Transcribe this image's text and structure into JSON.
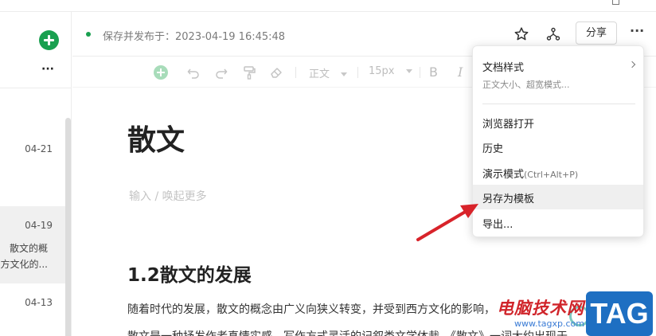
{
  "header": {
    "status_text": "保存并发布于：2023-04-19 16:45:48",
    "share_label": "分享",
    "more_label": "···"
  },
  "sidebar": {
    "more_label": "···",
    "items": [
      {
        "date": "04-21",
        "snippet1": "",
        "snippet2": ""
      },
      {
        "date": "04-19",
        "snippet1": "散文的概",
        "snippet2": "方文化的..."
      },
      {
        "date": "04-13",
        "snippet1": "",
        "snippet2": ""
      }
    ]
  },
  "toolbar": {
    "style_select": "正文",
    "size_select": "15px",
    "bold_label": "B",
    "italic_label": "I"
  },
  "editor": {
    "title": "散文",
    "placeholder": "输入 / 唤起更多",
    "heading": "1.2散文的发展",
    "paragraph1": "随着时代的发展，散文的概念由广义向狭义转变，并受到西方文化的影响，",
    "paragraph2": "散文是一种抒发作者真情实感、写作方式灵活的记叙类文学体裁。《散文》一词大约出现于"
  },
  "menu": {
    "items": [
      {
        "label": "文档样式",
        "sub": "正文大小、超宽模式...",
        "has_submenu": true
      },
      {
        "label": "浏览器打开"
      },
      {
        "label": "历史"
      },
      {
        "label": "演示模式",
        "hint": "(Ctrl+Alt+P)"
      },
      {
        "label": "另存为模板",
        "highlighted": true
      },
      {
        "label": "导出..."
      }
    ]
  },
  "watermark": {
    "text": "电脑技术网",
    "url": "www.tagxp.com",
    "tag": "TAG"
  },
  "colors": {
    "brand_green": "#1aa050",
    "arrow_red": "#d8232a",
    "tag_blue": "#1e6fc2"
  }
}
